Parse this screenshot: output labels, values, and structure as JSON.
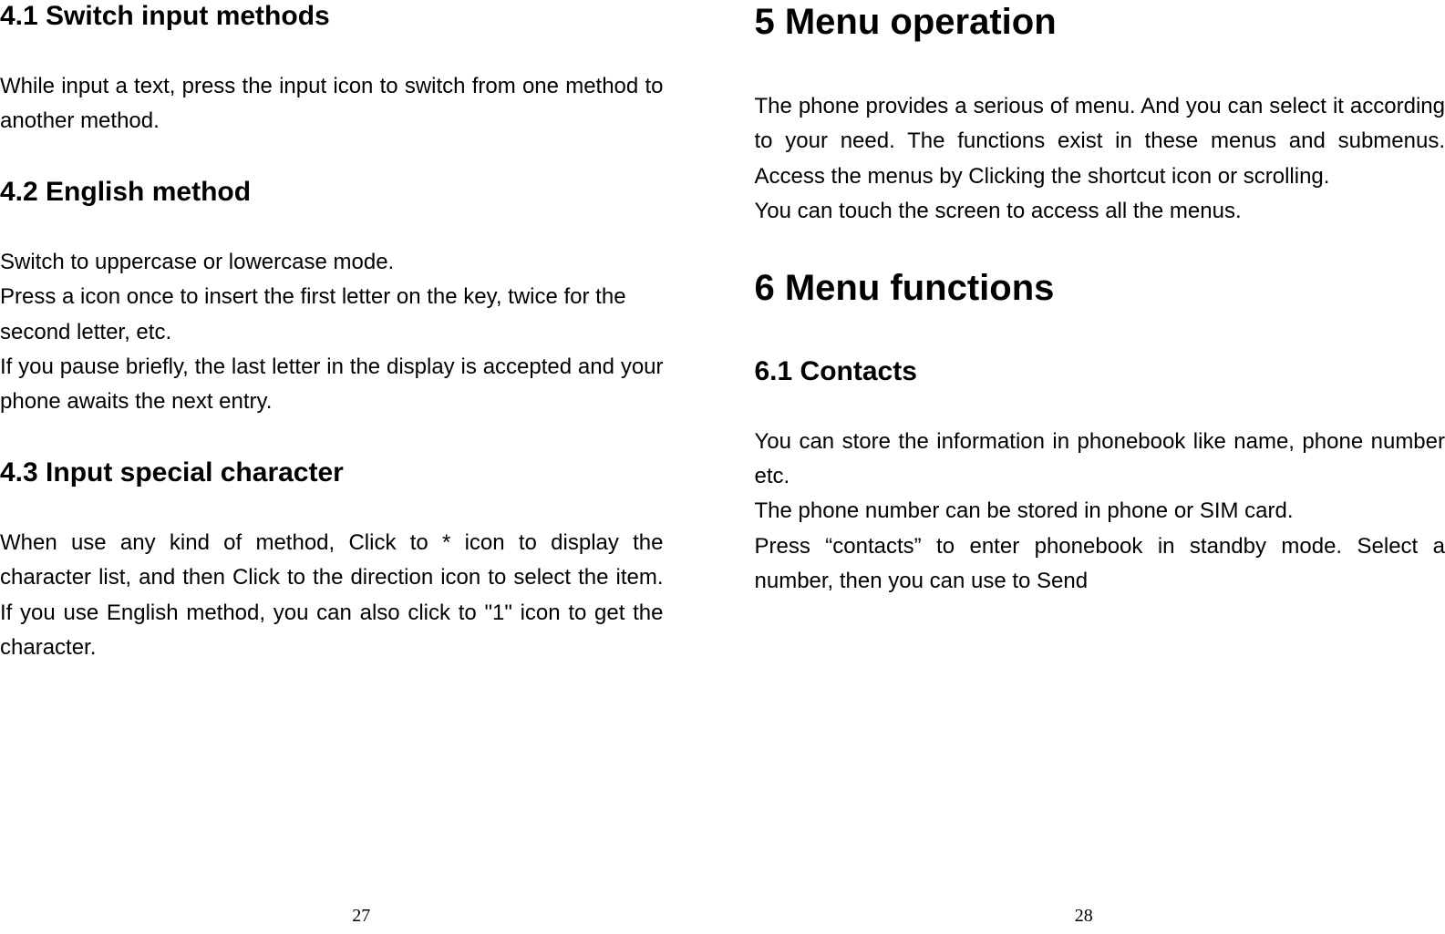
{
  "left": {
    "section_4_1_heading": "4.1 Switch input methods",
    "section_4_1_p1": "While input a text, press the input icon to switch from one method to another method.",
    "section_4_2_heading": "4.2 English method",
    "section_4_2_p1": "Switch to uppercase or lowercase mode.",
    "section_4_2_p2": "Press a icon once to insert the first letter on the key, twice for the second letter, etc.",
    "section_4_2_p3": "If you pause briefly, the last letter in the display is accepted and your phone awaits the next entry.",
    "section_4_3_heading": "4.3 Input special character",
    "section_4_3_p1": "When use any kind of method, Click to * icon to display the character list, and then Click to the direction icon to select the item. If you use English method, you can also click to \"1\" icon to get the character.",
    "page_number": "27"
  },
  "right": {
    "section_5_heading": "5 Menu operation",
    "section_5_p1": "The phone provides a serious of menu. And you can select it according to your need. The functions exist in these menus and submenus. Access the menus by Clicking the shortcut icon or scrolling.",
    "section_5_p2": "You can touch the screen to access all the menus.",
    "section_6_heading": "6 Menu functions",
    "section_6_1_heading": "6.1 Contacts",
    "section_6_1_p1": "You can store the information in phonebook like name, phone number etc.",
    "section_6_1_p2": "The phone number can be stored in phone or SIM card.",
    "section_6_1_p3": "Press “contacts” to enter phonebook in standby mode. Select a number, then you can use to Send",
    "page_number": "28"
  }
}
